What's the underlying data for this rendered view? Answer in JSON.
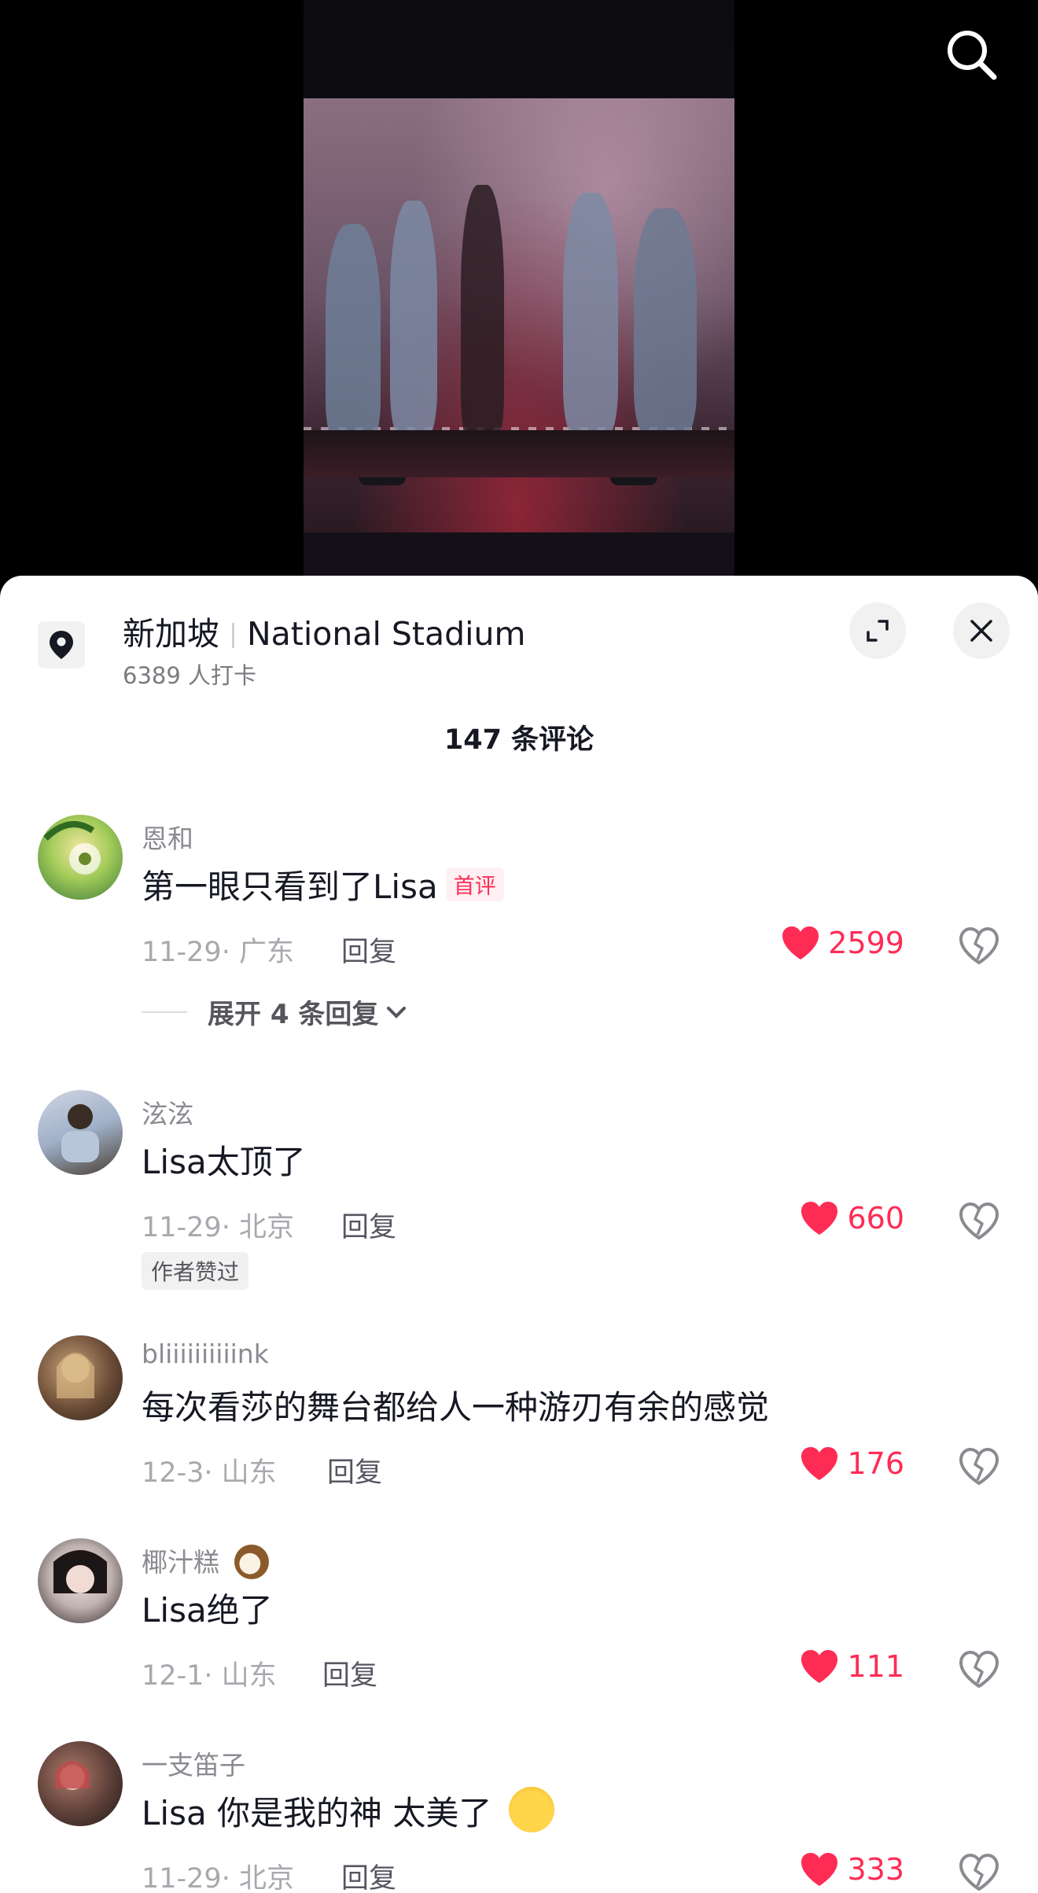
{
  "header": {
    "search_icon": "search-icon"
  },
  "location": {
    "city": "新加坡",
    "venue": "National Stadium",
    "checkins": "6389 人打卡",
    "icon": "location-pin-icon"
  },
  "comments_header": {
    "count_label": "147 条评论"
  },
  "comments": [
    {
      "user": "恩和",
      "text": "第一眼只看到了Lisa",
      "badge": "首评",
      "date_location": "11-29· 广东",
      "reply_label": "回复",
      "likes": "2599",
      "expand_replies": "展开 4 条回复"
    },
    {
      "user": "泫泫",
      "text": "Lisa太顶了",
      "date_location": "11-29· 北京",
      "reply_label": "回复",
      "likes": "660",
      "author_liked": "作者赞过"
    },
    {
      "user": "bliiiiiiiiiink",
      "text": "每次看莎的舞台都给人一种游刃有余的感觉",
      "date_location": "12-3· 山东",
      "reply_label": "回复",
      "likes": "176"
    },
    {
      "user": "椰汁糕",
      "text": "Lisa绝了",
      "date_location": "12-1· 山东",
      "reply_label": "回复",
      "likes": "111"
    },
    {
      "user": "一支笛子",
      "text": "Lisa 你是我的神 太美了",
      "date_location": "11-29· 北京",
      "reply_label": "回复",
      "likes": "333"
    }
  ],
  "colors": {
    "accent": "#fe2c55",
    "text_primary": "#161823",
    "text_secondary": "#8a8b91"
  }
}
